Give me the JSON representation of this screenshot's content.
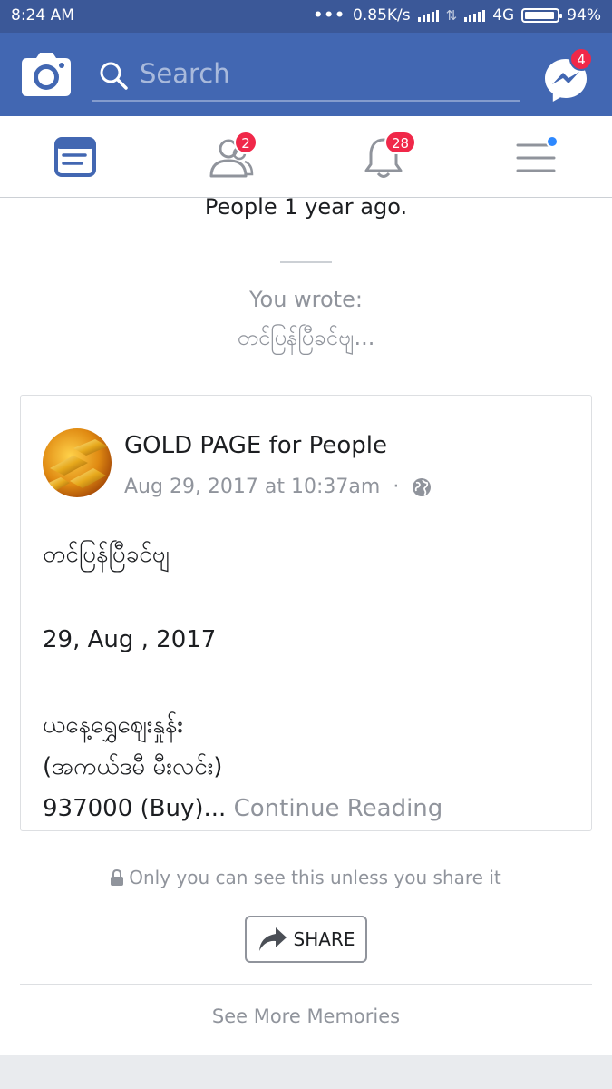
{
  "status_bar": {
    "time": "8:24 AM",
    "network_speed": "0.85K/s",
    "network_type": "4G",
    "battery": "94%",
    "battery_level": 0.94
  },
  "app_bar": {
    "search_placeholder": "Search",
    "messenger_badge": "4",
    "icons": [
      "camera-icon",
      "search-icon",
      "messenger-icon"
    ]
  },
  "nav": {
    "tabs": [
      {
        "name": "news-feed",
        "icon": "news-feed-icon",
        "badge": ""
      },
      {
        "name": "friend-requests",
        "icon": "friends-icon",
        "badge": "2"
      },
      {
        "name": "notifications",
        "icon": "bell-icon",
        "badge": "28"
      },
      {
        "name": "menu",
        "icon": "menu-icon",
        "badge": ""
      }
    ],
    "active_color": "#4267b2"
  },
  "memory": {
    "previous_line": "People 1 year ago.",
    "you_wrote": "You wrote:",
    "you_wrote_snippet": "တင်ပြန်ပြီခင်ဗျ..."
  },
  "post": {
    "page_name": "GOLD PAGE for People",
    "timestamp": "Aug 29, 2017 at 10:37am",
    "separator": "·",
    "body_lines": [
      "တင်ပြန်ပြီခင်ဗျ",
      "29, Aug , 2017",
      "ယနေ့ရွှေဈေးနှုန်း",
      "(အကယ်ဒမီ မီးလင်း)"
    ],
    "last_line": "937000 (Buy)...",
    "continue_reading": "Continue Reading"
  },
  "privacy_note": "Only you can see this unless you share it",
  "share_label": "SHARE",
  "see_more": "See More Memories",
  "colors": {
    "brand": "#4267b2",
    "status_bar": "#3b5898",
    "badge": "#f02849",
    "muted_text": "#90949c"
  }
}
